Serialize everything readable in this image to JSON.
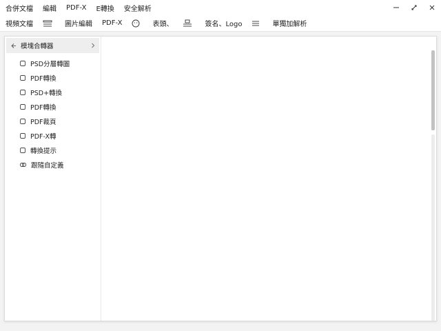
{
  "menu": {
    "items": [
      "合併文檔",
      "編輯",
      "PDF-X",
      "E轉換",
      "安全解析"
    ]
  },
  "window": {
    "minimize_icon": "minimize-icon",
    "restore_icon": "restore-icon",
    "close_icon": "close-icon"
  },
  "toolbar": {
    "items": [
      {
        "label": "視頻文檔",
        "icon": ""
      },
      {
        "label": "",
        "icon": "layers-icon"
      },
      {
        "label": "圖片編輯",
        "icon": ""
      },
      {
        "label": "PDF-X",
        "icon": ""
      },
      {
        "label": "",
        "icon": "face-icon"
      },
      {
        "label": "表頭、",
        "icon": ""
      },
      {
        "label": "",
        "icon": "stamp-icon"
      },
      {
        "label": "簽名、Logo",
        "icon": ""
      },
      {
        "label": "",
        "icon": "hamburger-icon"
      },
      {
        "label": "單獨加解析",
        "icon": ""
      }
    ]
  },
  "sidebar": {
    "header": {
      "label": "模塊合轉器",
      "icon": "left-arrow-icon"
    },
    "items": [
      {
        "label": "PSD分層轉圖",
        "icon": "checkbox-icon"
      },
      {
        "label": "PDF轉換",
        "icon": "checkbox-icon"
      },
      {
        "label": "PSD+轉換",
        "icon": "checkbox-icon"
      },
      {
        "label": "PDF轉換",
        "icon": "checkbox-icon"
      },
      {
        "label": "PDF裁頁",
        "icon": "checkbox-icon"
      },
      {
        "label": "PDF-X轉",
        "icon": "checkbox-icon"
      },
      {
        "label": "轉換提示",
        "icon": "checkbox-icon"
      },
      {
        "label": "跟隨自定義",
        "icon": "link-icon"
      }
    ]
  },
  "colors": {
    "background": "#f3f3f3",
    "panel": "#ffffff",
    "header_highlight": "#eeeeee",
    "scroll_thumb": "#c2c2c2"
  }
}
